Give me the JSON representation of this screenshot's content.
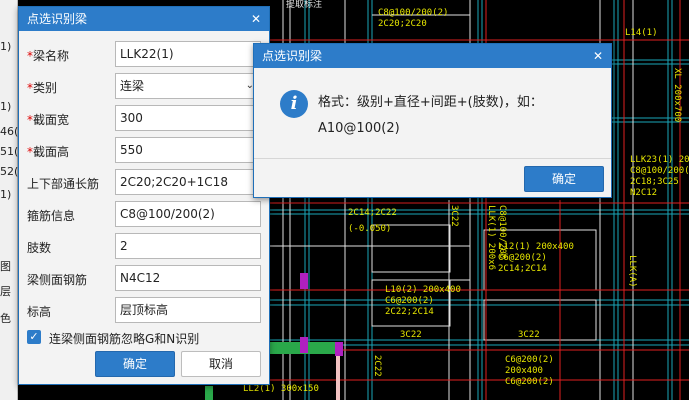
{
  "main_dialog": {
    "title": "点选识别梁",
    "close": "✕",
    "fields": [
      {
        "label": "梁名称",
        "required": "*",
        "value": "LLK22(1)"
      },
      {
        "label": "类别",
        "required": "*",
        "value": "连梁"
      },
      {
        "label": "截面宽",
        "required": "*",
        "value": "300"
      },
      {
        "label": "截面高",
        "required": "*",
        "value": "550"
      },
      {
        "label": "上下部通长筋",
        "required": "",
        "value": "2C20;2C20+1C18"
      },
      {
        "label": "箍筋信息",
        "required": "",
        "value": "C8@100/200(2)"
      },
      {
        "label": "肢数",
        "required": "",
        "value": "2"
      },
      {
        "label": "梁侧面钢筋",
        "required": "",
        "value": "N4C12"
      },
      {
        "label": "标高",
        "required": "",
        "value": "层顶标高"
      }
    ],
    "checkbox_label": "连梁侧面钢筋忽略G和N识别",
    "ok_label": "确定",
    "cancel_label": "取消"
  },
  "info_dialog": {
    "title": "点选识别梁",
    "close": "✕",
    "icon": "i",
    "line1": "格式：级别+直径+间距+(肢数)，如：",
    "line2": "A10@100(2)",
    "ok_label": "确定"
  },
  "left_strip": [
    "1)",
    "1)",
    "46(",
    "51(",
    "52(",
    "1)",
    "图",
    "层",
    "色"
  ],
  "cad_labels": {
    "top1": "C8@100/200(2)",
    "top2": "2C20;2C20",
    "l14": "L14(1)",
    "xl": "XL 200x700",
    "llk23": "LLK23(1) 200x",
    "llk23b": "C8@100/200(2",
    "llk23c": "2C18;3C25",
    "llk23d": "N2C12",
    "mid1": "2C14;2C22",
    "mid2": "(-0.050)",
    "l12a": "L12(1) 200x400",
    "l12b": "C6@200(2)",
    "l12c": "2C14;2C14",
    "l10a": "L10(2) 200x400",
    "l10b": "C6@200(2)",
    "l10c": "2C22;2C14",
    "v3c22": "3C22",
    "h3c22a": "3C22",
    "h3c22b": "3C22",
    "llka": "LLK(A)",
    "c6bot": "C6@200(2)",
    "c6bot2": "200x400",
    "c6bot3": "C6@200(2)",
    "ll2": "LL2(1) 300x150",
    "v2c22": "2C22",
    "llk1a": "LLK(1) 200x6",
    "llk1b": "C8@100/200",
    "top_tab": "提取标注"
  }
}
